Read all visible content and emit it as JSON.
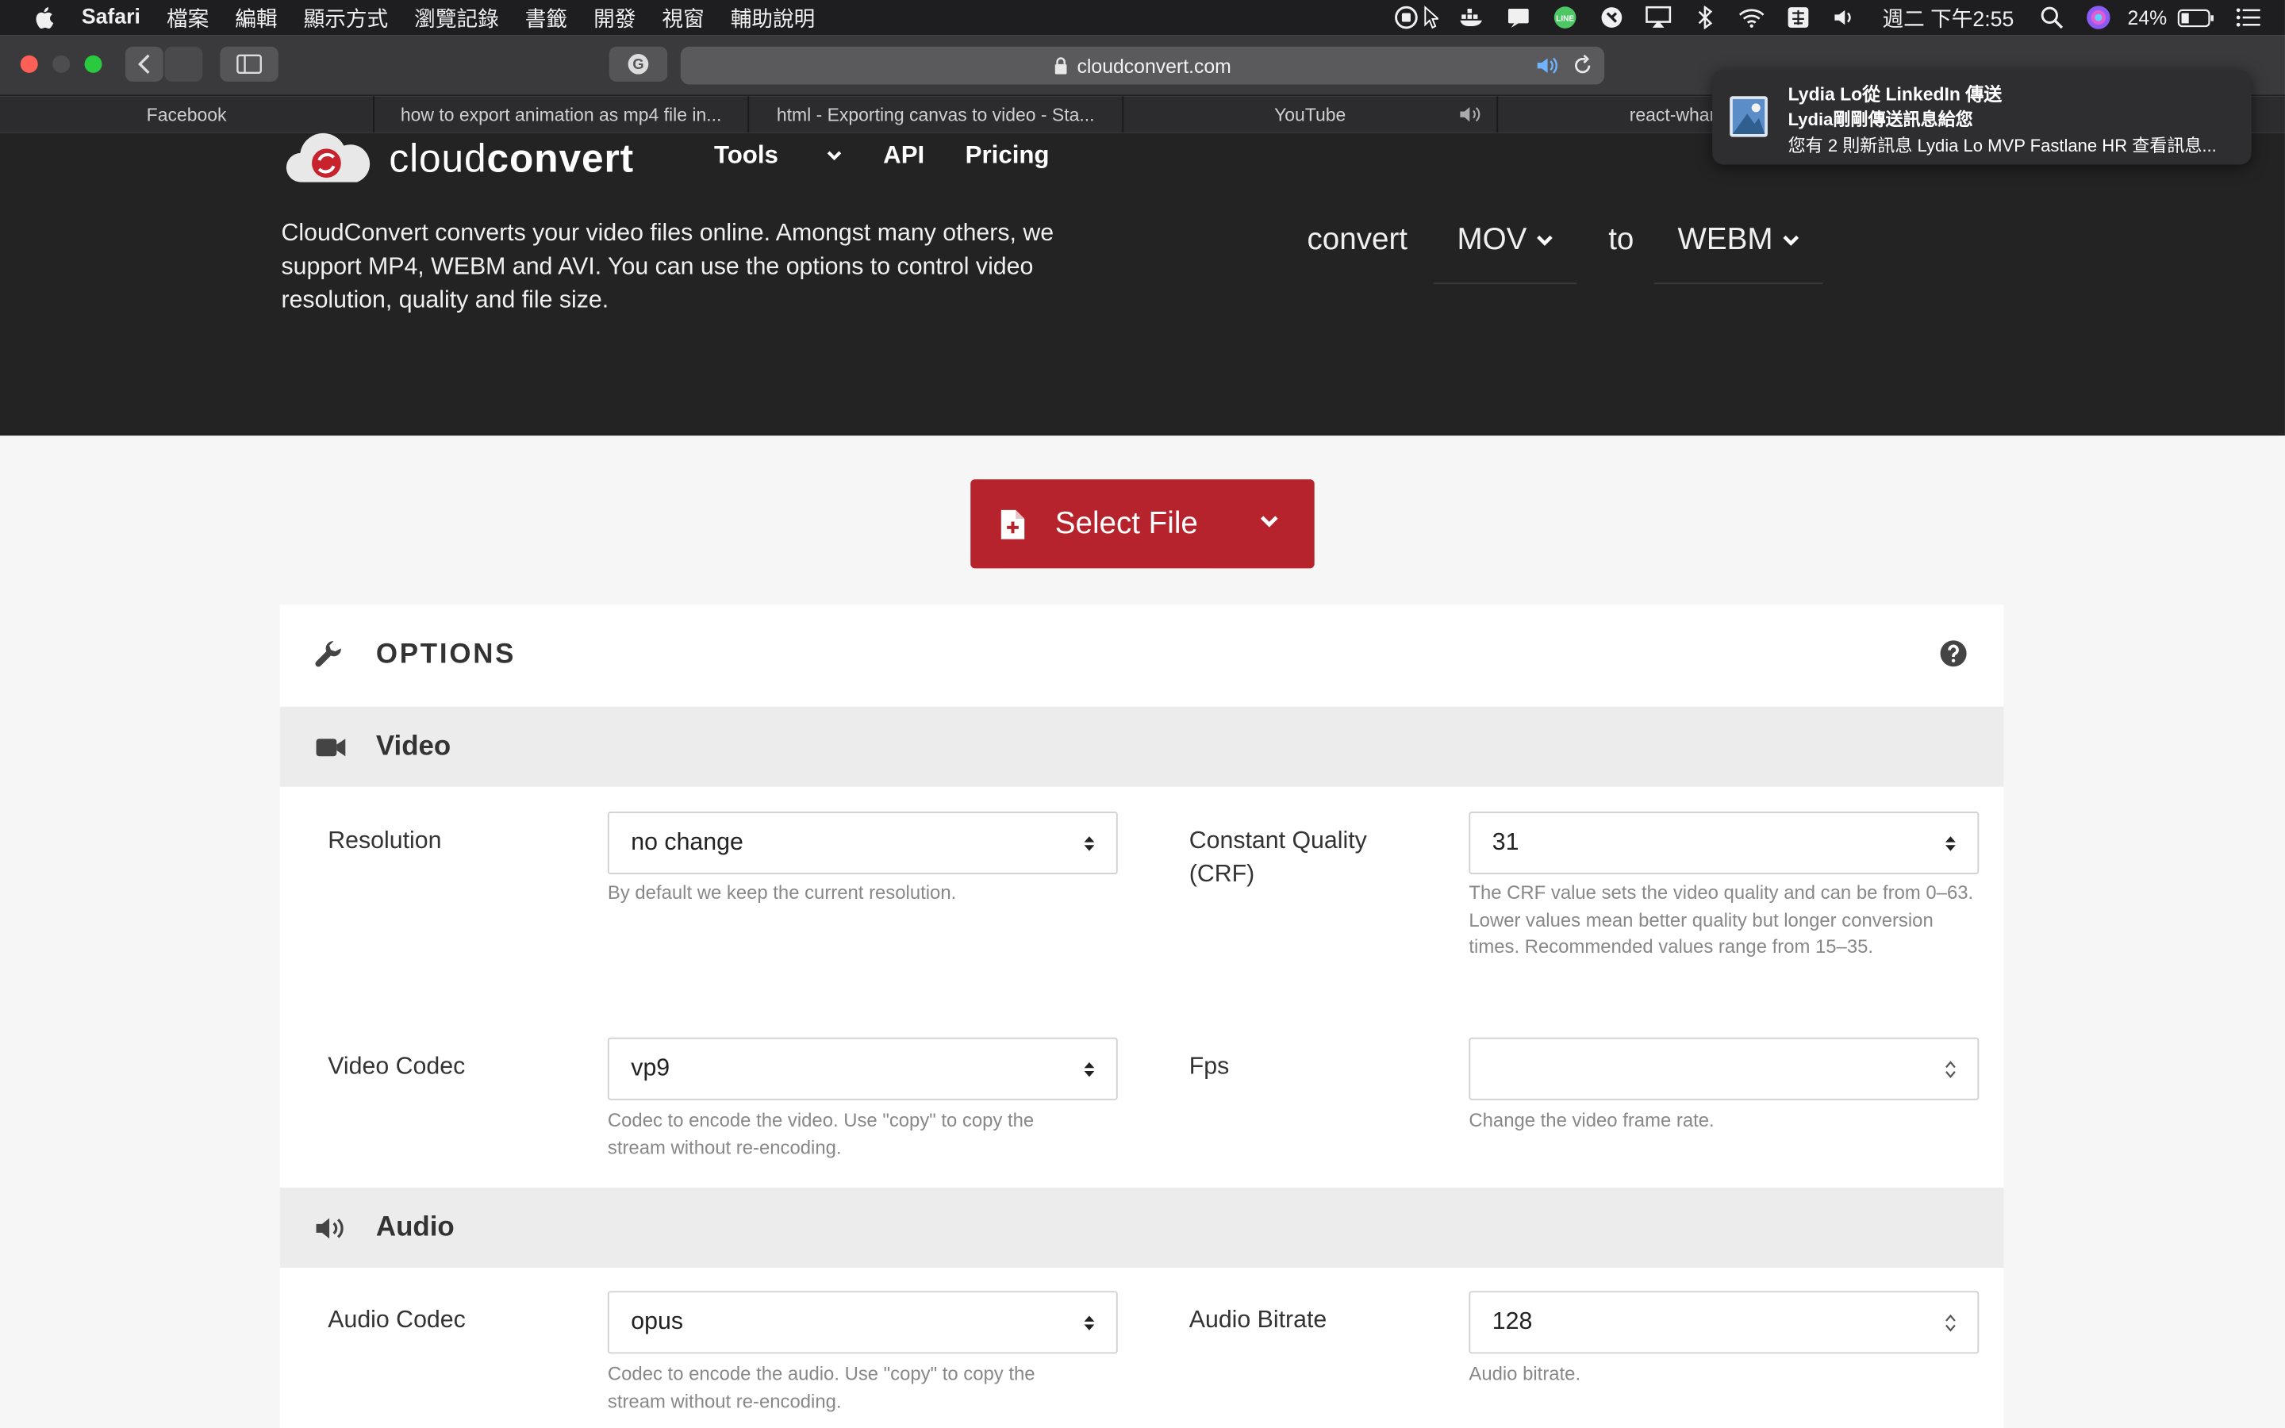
{
  "menubar": {
    "items": [
      "Safari",
      "檔案",
      "編輯",
      "顯示方式",
      "瀏覽記錄",
      "書籤",
      "開發",
      "視窗",
      "輔助說明"
    ],
    "clock": "週二 下午2:55",
    "battery": "24%"
  },
  "browser": {
    "url": "cloudconvert.com",
    "tabs": [
      {
        "title": "Facebook"
      },
      {
        "title": "how to export animation as mp4 file in..."
      },
      {
        "title": "html - Exporting canvas to video - Sta..."
      },
      {
        "title": "YouTube"
      },
      {
        "title": "react-whamm"
      }
    ]
  },
  "notification": {
    "title": "Lydia Lo從 LinkedIn 傳送",
    "subtitle": "Lydia剛剛傳送訊息給您",
    "body": "您有 2 則新訊息 Lydia Lo MVP Fastlane HR 查看訊息..."
  },
  "site": {
    "logo_light": "cloud",
    "logo_bold": "convert",
    "nav": {
      "tools": "Tools",
      "api": "API",
      "pricing": "Pricing"
    },
    "intro": "CloudConvert converts your video files online. Amongst many others, we support MP4, WEBM and AVI. You can use the options to control video resolution, quality and file size.",
    "convert_label": "convert",
    "from_format": "MOV",
    "to_label": "to",
    "to_format": "WEBM"
  },
  "main": {
    "select_file": "Select File",
    "options_title": "OPTIONS",
    "video_section": "Video",
    "audio_section": "Audio",
    "fields": {
      "resolution": {
        "label": "Resolution",
        "value": "no change",
        "hint": "By default we keep the current resolution."
      },
      "crf": {
        "label": "Constant Quality (CRF)",
        "value": "31",
        "hint": "The CRF value sets the video quality and can be from 0–63. Lower values mean better quality but longer conversion times. Recommended values range from 15–35."
      },
      "video_codec": {
        "label": "Video Codec",
        "value": "vp9",
        "hint": "Codec to encode the video. Use \"copy\" to copy the stream without re-encoding."
      },
      "fps": {
        "label": "Fps",
        "value": "",
        "hint": "Change the video frame rate."
      },
      "audio_codec": {
        "label": "Audio Codec",
        "value": "opus",
        "hint": "Codec to encode the audio. Use \"copy\" to copy the stream without re-encoding."
      },
      "audio_bitrate": {
        "label": "Audio Bitrate",
        "value": "128",
        "hint": "Audio bitrate."
      }
    }
  },
  "colors": {
    "brand_red": "#b7232c",
    "header_dark": "#232324"
  }
}
